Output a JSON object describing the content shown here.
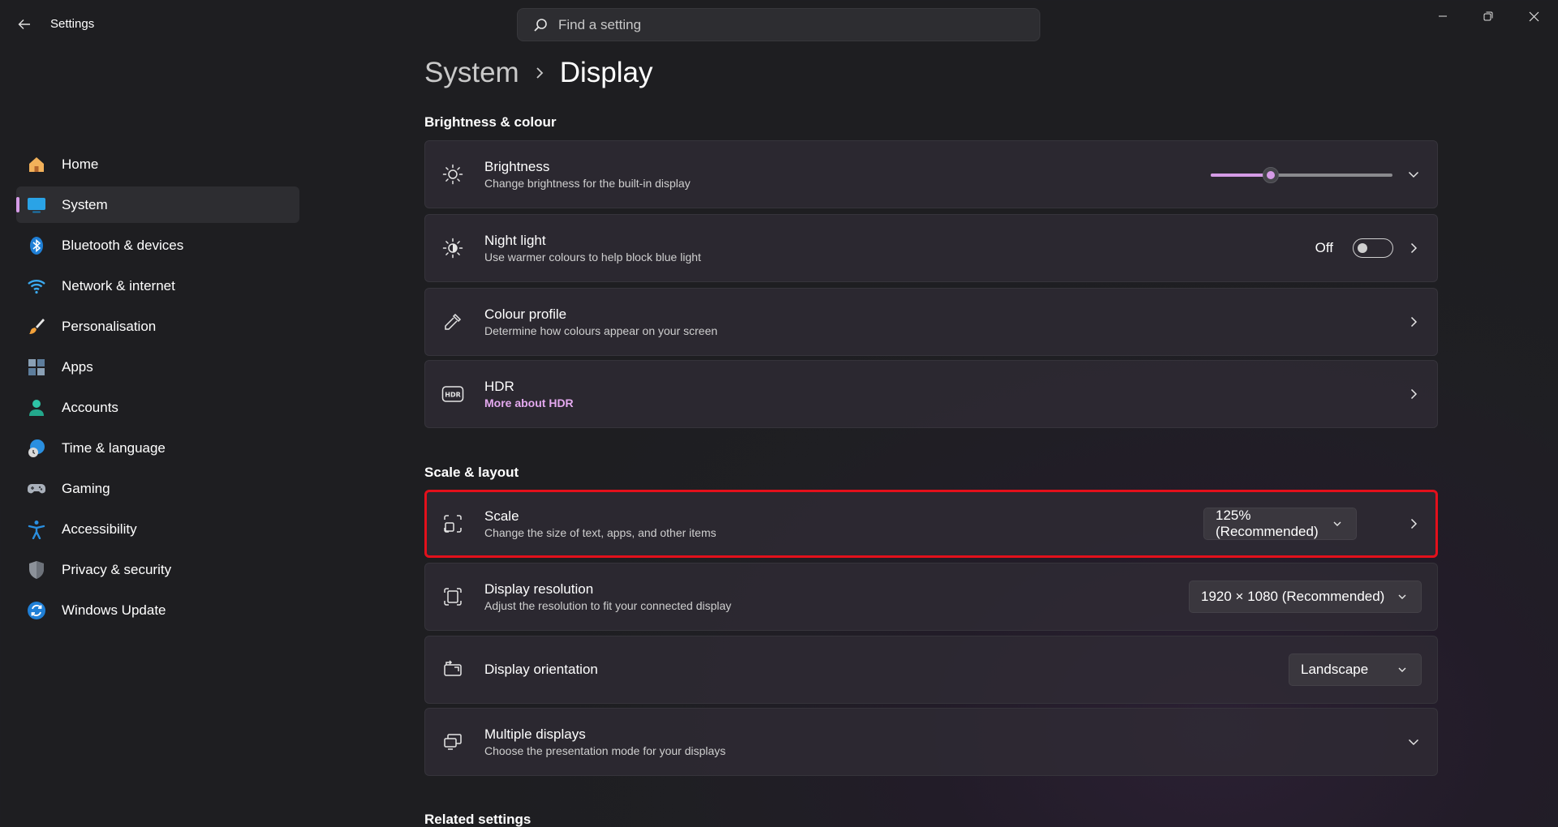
{
  "window": {
    "title": "Settings",
    "search_placeholder": "Find a setting"
  },
  "sidebar": {
    "items": [
      {
        "label": "Home",
        "icon": "home-icon"
      },
      {
        "label": "System",
        "icon": "monitor-icon",
        "active": true
      },
      {
        "label": "Bluetooth & devices",
        "icon": "bluetooth-icon"
      },
      {
        "label": "Network & internet",
        "icon": "wifi-icon"
      },
      {
        "label": "Personalisation",
        "icon": "brush-icon"
      },
      {
        "label": "Apps",
        "icon": "apps-icon"
      },
      {
        "label": "Accounts",
        "icon": "person-icon"
      },
      {
        "label": "Time & language",
        "icon": "globe-clock-icon"
      },
      {
        "label": "Gaming",
        "icon": "gamepad-icon"
      },
      {
        "label": "Accessibility",
        "icon": "accessibility-icon"
      },
      {
        "label": "Privacy & security",
        "icon": "shield-icon"
      },
      {
        "label": "Windows Update",
        "icon": "update-icon"
      }
    ]
  },
  "breadcrumb": {
    "parent": "System",
    "current": "Display"
  },
  "sections": {
    "brightness_colour": {
      "title": "Brightness & colour",
      "brightness": {
        "title": "Brightness",
        "subtitle": "Change brightness for the built-in display",
        "level": 0.33
      },
      "night_light": {
        "title": "Night light",
        "subtitle": "Use warmer colours to help block blue light",
        "state": "Off"
      },
      "colour_profile": {
        "title": "Colour profile",
        "subtitle": "Determine how colours appear on your screen"
      },
      "hdr": {
        "title": "HDR",
        "link": "More about HDR"
      }
    },
    "scale_layout": {
      "title": "Scale & layout",
      "scale": {
        "title": "Scale",
        "subtitle": "Change the size of text, apps, and other items",
        "value": "125% (Recommended)"
      },
      "resolution": {
        "title": "Display resolution",
        "subtitle": "Adjust the resolution to fit your connected display",
        "value": "1920 × 1080 (Recommended)"
      },
      "orientation": {
        "title": "Display orientation",
        "value": "Landscape"
      },
      "multiple": {
        "title": "Multiple displays",
        "subtitle": "Choose the presentation mode for your displays"
      }
    },
    "related": {
      "title": "Related settings"
    }
  },
  "colors": {
    "accent": "#d59be6",
    "highlight": "#e3101b"
  }
}
